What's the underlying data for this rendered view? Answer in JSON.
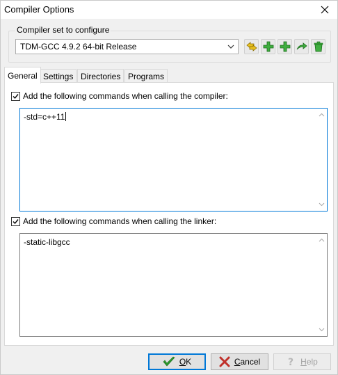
{
  "window": {
    "title": "Compiler Options",
    "close_icon": "close-icon"
  },
  "compiler_set": {
    "group_label": "Compiler set to configure",
    "selected": "TDM-GCC 4.9.2 64-bit Release",
    "toolbar": [
      {
        "name": "rename-compiler-set",
        "icon": "rename-icon",
        "color": "#d4a400"
      },
      {
        "name": "add-compiler-set",
        "icon": "plus-icon",
        "color": "#2e9b2e"
      },
      {
        "name": "add-empty-compiler-set",
        "icon": "plus-icon",
        "color": "#2e9b2e"
      },
      {
        "name": "find-compilers",
        "icon": "arrow-icon",
        "color": "#2e9b2e"
      },
      {
        "name": "delete-compiler-set",
        "icon": "trash-icon",
        "color": "#2e9b2e"
      }
    ]
  },
  "tabs": [
    {
      "label": "General",
      "active": true
    },
    {
      "label": "Settings",
      "active": false
    },
    {
      "label": "Directories",
      "active": false
    },
    {
      "label": "Programs",
      "active": false
    }
  ],
  "general": {
    "compiler_check_label": "Add the following commands when calling the compiler:",
    "compiler_check": true,
    "compiler_commands": "-std=c++11",
    "linker_check_label": "Add the following commands when calling the linker:",
    "linker_check": true,
    "linker_commands": "-static-libgcc"
  },
  "buttons": {
    "ok_mnemonic": "O",
    "ok_rest": "K",
    "cancel_mnemonic": "C",
    "cancel_rest": "ancel",
    "help_mnemonic": "H",
    "help_rest": "elp"
  },
  "colors": {
    "accent": "#0078d7",
    "ok_check": "#2e9b2e",
    "cancel_x": "#c0302a"
  }
}
